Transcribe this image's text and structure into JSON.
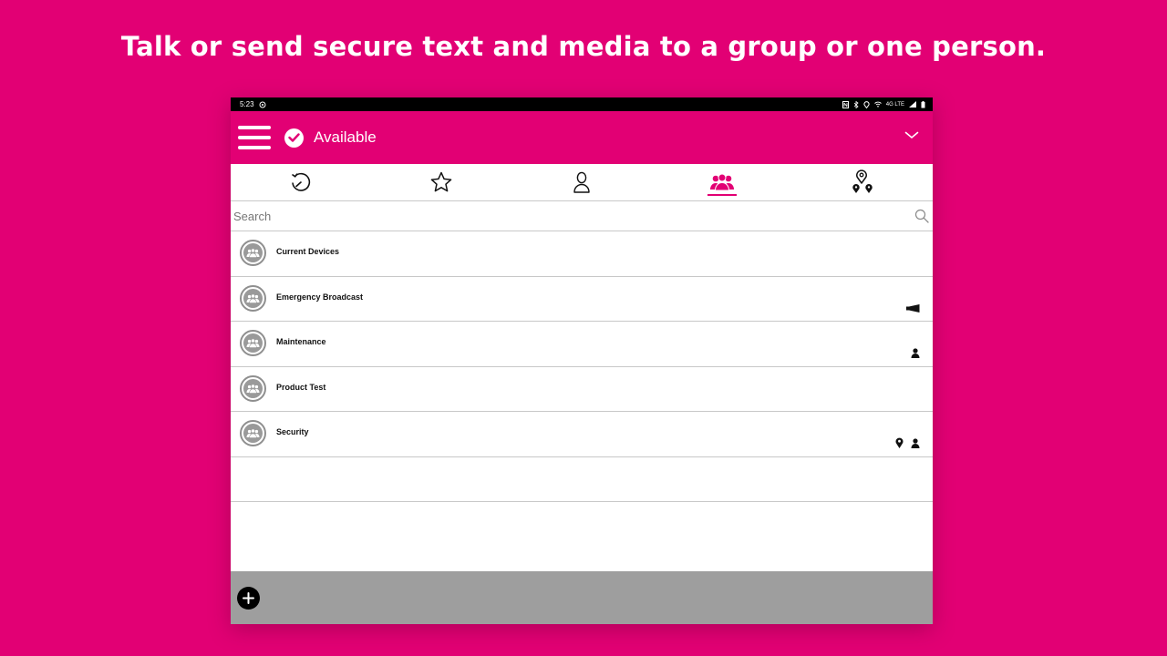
{
  "headline": "Talk or send secure text and media to a group or one person.",
  "statusbar": {
    "time": "5:23",
    "network": "4G LTE"
  },
  "appbar": {
    "status": "Available"
  },
  "tabs": [
    {
      "name": "recents",
      "icon": "history-icon",
      "active": false
    },
    {
      "name": "favorites",
      "icon": "star-icon",
      "active": false
    },
    {
      "name": "contacts",
      "icon": "person-icon",
      "active": false
    },
    {
      "name": "groups",
      "icon": "group-icon",
      "active": true
    },
    {
      "name": "map",
      "icon": "location-pins-icon",
      "active": false
    }
  ],
  "search": {
    "placeholder": "Search"
  },
  "groups": [
    {
      "name": "Current Devices",
      "indicators": []
    },
    {
      "name": "Emergency Broadcast",
      "indicators": [
        "megaphone-icon"
      ]
    },
    {
      "name": "Maintenance",
      "indicators": [
        "person-icon"
      ]
    },
    {
      "name": "Product Test",
      "indicators": []
    },
    {
      "name": "Security",
      "indicators": [
        "location-pin-icon",
        "person-icon"
      ]
    }
  ],
  "colors": {
    "brand": "#e20074",
    "bottom_bar": "#9e9e9e",
    "divider": "#c8c8c8"
  }
}
